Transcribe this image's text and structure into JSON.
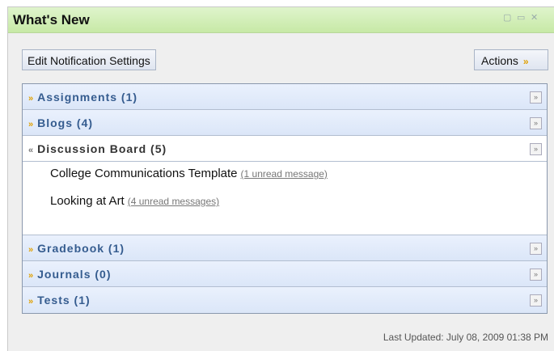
{
  "window": {
    "title": "What's New",
    "controls": [
      "maximize-icon",
      "minimize-icon",
      "close-icon"
    ]
  },
  "toolbar": {
    "edit_label": "Edit Notification Settings",
    "actions_label": "Actions"
  },
  "sections": [
    {
      "label": "Assignments (1)",
      "expanded": false
    },
    {
      "label": "Blogs (4)",
      "expanded": false
    },
    {
      "label": "Discussion Board (5)",
      "expanded": true
    },
    {
      "label": "Gradebook (1)",
      "expanded": false
    },
    {
      "label": "Journals (0)",
      "expanded": false
    },
    {
      "label": "Tests (1)",
      "expanded": false
    }
  ],
  "discussion_items": [
    {
      "title": "College Communications Template",
      "unread": "(1 unread message)"
    },
    {
      "title": "Looking at Art",
      "unread": "(4 unread messages)"
    }
  ],
  "footer": {
    "last_updated": "Last Updated: July 08, 2009 01:38 PM"
  }
}
